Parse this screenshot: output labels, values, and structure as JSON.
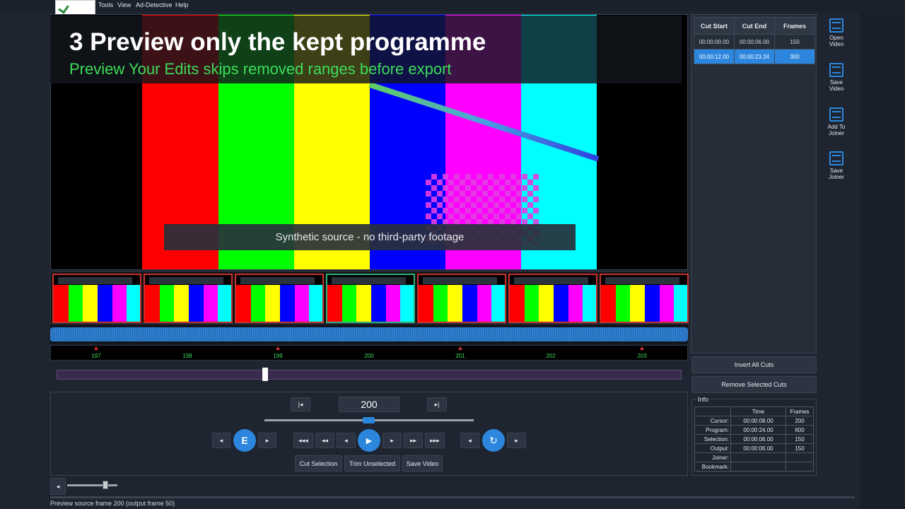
{
  "menu": {
    "items": [
      "Tools",
      "View",
      "Ad-Detective",
      "Help"
    ]
  },
  "slide": {
    "title": "3  Preview only the kept programme",
    "subtitle": "Preview Your Edits skips removed ranges before export"
  },
  "video": {
    "caption": "Synthetic source - no third-party footage",
    "bar_colors": [
      "#000000",
      "#ff0000",
      "#00ff00",
      "#ffff00",
      "#0000ff",
      "#ff00ff",
      "#00ffff",
      "#000000"
    ]
  },
  "timeline": {
    "frame_labels": [
      "197",
      "198",
      "199",
      "200",
      "201",
      "202",
      "203"
    ]
  },
  "controls": {
    "frame_number": "200",
    "edit_button": "E",
    "cut_selection": "Cut Selection",
    "trim_unselected": "Trim Unselected",
    "save_video": "Save Video",
    "go_start_glyph": "|◂",
    "go_end_glyph": "▸|",
    "prev_glyph": "◂",
    "next_glyph": "▸",
    "rew3_glyph": "◂◂◂",
    "rew2_glyph": "◂◂",
    "rew1_glyph": "◂",
    "play_glyph": "▶",
    "fwd1_glyph": "▸",
    "fwd2_glyph": "▸▸",
    "fwd3_glyph": "▸▸▸",
    "loop_glyph": "↻",
    "volume_glyph": "◂"
  },
  "cuts": {
    "headers": [
      "Cut Start",
      "Cut End",
      "Frames"
    ],
    "rows": [
      {
        "start": "00:00:00.00",
        "end": "00:00:06.00",
        "frames": "150"
      },
      {
        "start": "00:00:12.00",
        "end": "00:00:23.24",
        "frames": "300"
      }
    ],
    "invert_all": "Invert All Cuts",
    "remove_selected": "Remove Selected Cuts"
  },
  "info": {
    "label": "Info",
    "headers": [
      "",
      "Time",
      "Frames"
    ],
    "rows": [
      {
        "label": "Cursor:",
        "time": "00:00:08.00",
        "frames": "200"
      },
      {
        "label": "Program:",
        "time": "00:00:24.00",
        "frames": "600"
      },
      {
        "label": "Selection:",
        "time": "00:00:06.00",
        "frames": "150"
      },
      {
        "label": "Output:",
        "time": "00:00:06.00",
        "frames": "150"
      },
      {
        "label": "Joiner:",
        "time": "",
        "frames": ""
      },
      {
        "label": "Bookmark:",
        "time": "",
        "frames": ""
      }
    ]
  },
  "toolbar": {
    "open_video": [
      "Open",
      "Video"
    ],
    "save_video": [
      "Save",
      "Video"
    ],
    "add_to_joiner": [
      "Add To",
      "Joiner"
    ],
    "save_joiner": [
      "Save",
      "Joiner"
    ]
  },
  "status": {
    "text": "Preview source frame 200 (output frame 50)"
  }
}
